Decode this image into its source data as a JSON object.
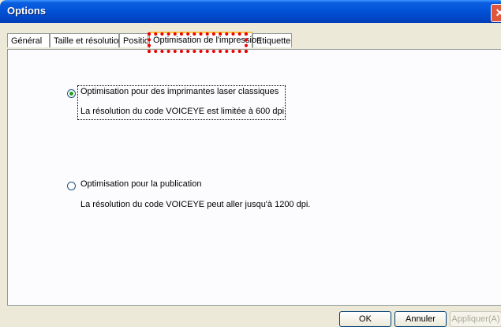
{
  "window": {
    "title": "Options",
    "close_glyph": "✕"
  },
  "tabs": [
    {
      "label": "Général"
    },
    {
      "label": "Taille et résolution"
    },
    {
      "label": "Position"
    },
    {
      "label": "Optimisation de l'impression",
      "active": true
    },
    {
      "label": "Etiquette"
    }
  ],
  "page": {
    "option1": {
      "label": "Optimisation pour des imprimantes laser classiques",
      "description": "La résolution du code VOICEYE est limitée à 600 dpi.",
      "selected": true
    },
    "option2": {
      "label": "Optimisation pour la publication",
      "description": "La résolution du code VOICEYE peut aller jusqu'à 1200 dpi.",
      "selected": false
    }
  },
  "buttons": {
    "ok": "OK",
    "cancel": "Annuler",
    "apply": "Appliquer(A)"
  },
  "colors": {
    "title_bar": "#0253d9",
    "dialog_bg": "#ece9d8",
    "highlight": "#ee0000"
  }
}
